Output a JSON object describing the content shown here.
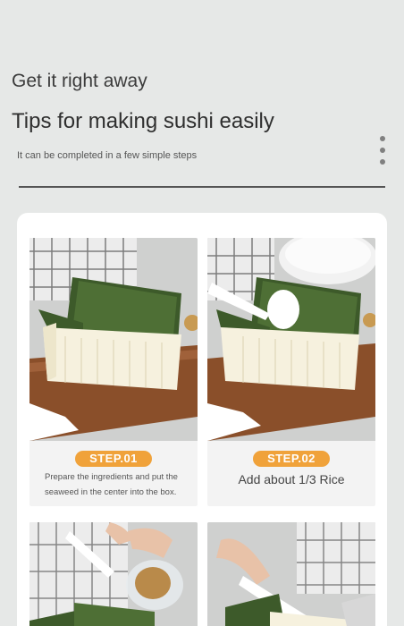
{
  "header": {
    "subtitle": "Get it right away",
    "title": "Tips for making sushi easily",
    "description": "It can be completed in a few simple steps"
  },
  "steps": [
    {
      "badge": "STEP.01",
      "text": "Prepare the ingredients and put the seaweed in the center into the box."
    },
    {
      "badge": "STEP.02",
      "text": "Add about 1/3 Rice"
    }
  ],
  "colors": {
    "background": "#e6e8e7",
    "accent": "#f0a23a",
    "panel": "#ffffff"
  }
}
